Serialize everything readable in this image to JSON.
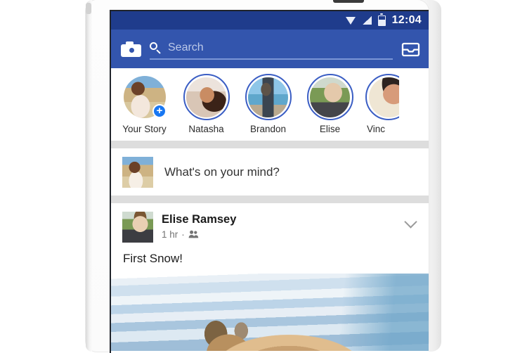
{
  "device": {
    "type": "smartphone-mockup",
    "speaker_icon": "speaker-grille"
  },
  "status_bar": {
    "time": "12:04",
    "icons": [
      "wifi-icon",
      "cellular-signal-icon",
      "battery-icon"
    ],
    "background": "#1f3c8c"
  },
  "app_header": {
    "background": "#3355ad",
    "camera_icon": "camera-icon",
    "search": {
      "icon": "search-icon",
      "placeholder": "Search",
      "value": ""
    },
    "messenger_icon": "inbox-icon"
  },
  "stories": {
    "items": [
      {
        "label": "Your Story",
        "has_ring": false,
        "badge": "+",
        "badge_icon": "plus-badge-icon"
      },
      {
        "label": "Natasha",
        "has_ring": true,
        "badge": ""
      },
      {
        "label": "Brandon",
        "has_ring": true,
        "badge": ""
      },
      {
        "label": "Elise",
        "has_ring": true,
        "badge": ""
      },
      {
        "label": "Vinc",
        "has_ring": true,
        "badge": ""
      }
    ]
  },
  "composer": {
    "avatar_icon": "user-avatar",
    "placeholder": "What's on your mind?"
  },
  "post": {
    "author": "Elise Ramsey",
    "timestamp": "1 hr",
    "separator": "·",
    "audience_icon": "friends-icon",
    "menu_icon": "chevron-down-icon",
    "message": "First Snow!",
    "photo_alt": "dog-in-snow-photo"
  },
  "colors": {
    "status_bar_blue": "#1f3c8c",
    "header_blue": "#3355ad",
    "accent_blue": "#1877f2",
    "story_ring": "#3b5ec4",
    "divider_grey": "#dddddd",
    "page_background": "#ffffff"
  }
}
